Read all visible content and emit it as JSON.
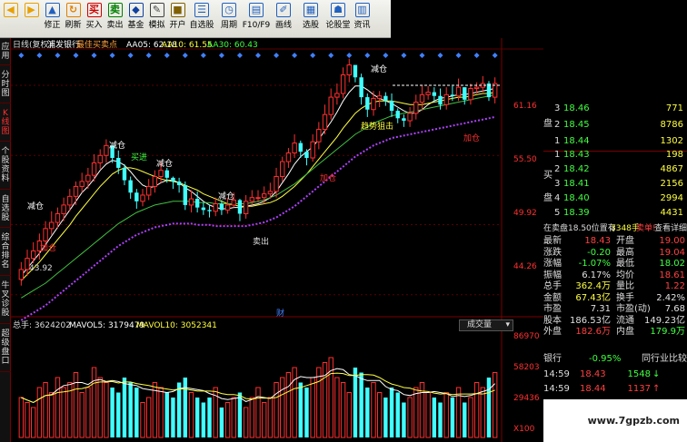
{
  "toolbar": {
    "buttons": [
      {
        "label": "",
        "icon": "back-arrow-icon",
        "color": "#e8a000"
      },
      {
        "label": "",
        "icon": "forward-arrow-icon",
        "color": "#e8a000"
      },
      {
        "label": "修正",
        "icon": "up-arrow-icon",
        "color": "#2060c0"
      },
      {
        "label": "刷新",
        "icon": "refresh-icon",
        "color": "#e08000"
      },
      {
        "label": "买入",
        "icon": "buy-icon",
        "color": "#d00000",
        "glyph": "买"
      },
      {
        "label": "卖出",
        "icon": "sell-icon",
        "color": "#008000",
        "glyph": "卖"
      },
      {
        "label": "基金",
        "icon": "fund-icon",
        "color": "#1040a0"
      },
      {
        "label": "模拟",
        "icon": "simulate-icon",
        "color": "#404040"
      },
      {
        "label": "开户",
        "icon": "lock-icon",
        "color": "#806000"
      },
      {
        "label": "自选股",
        "icon": "watchlist-icon",
        "color": "#2060c0",
        "wide": true
      },
      {
        "label": "周期",
        "icon": "period-icon",
        "color": "#2060c0",
        "wide": true
      },
      {
        "label": "F10/F9",
        "icon": "f10-icon",
        "color": "#2060c0",
        "wide": true
      },
      {
        "label": "画线",
        "icon": "pen-icon",
        "color": "#2060c0",
        "wide": true
      },
      {
        "label": "选股",
        "icon": "select-stock-icon",
        "color": "#2060c0",
        "wide": true
      },
      {
        "label": "论股堂",
        "icon": "forum-icon",
        "color": "#2060c0",
        "wide": true
      },
      {
        "label": "资讯",
        "icon": "news-icon",
        "color": "#2060c0"
      }
    ]
  },
  "left_tabs": [
    {
      "label": "应用"
    },
    {
      "label": "分时图"
    },
    {
      "label": "K线图",
      "active": true
    },
    {
      "label": "个股资料"
    },
    {
      "label": "自选股"
    },
    {
      "label": "综合排名"
    },
    {
      "label": "牛叉诊股"
    },
    {
      "label": "超级盘口"
    }
  ],
  "chart_header": {
    "period": "日线(复权)",
    "stock": "浦发银行",
    "indicator": "最佳买卖点",
    "ma5": "AA05: 62.18",
    "ma10": "AA10: 61.55",
    "ma30": "AA30: 60.43"
  },
  "price_axis": [
    "61.16",
    "55.50",
    "49.92",
    "44.26"
  ],
  "chart_labels": {
    "low": "43.92",
    "fin": "财",
    "trend": "趋势狙击",
    "jiacang": "加仓",
    "jiancang": "减仓",
    "maijin": "买进",
    "maichu": "卖出"
  },
  "volume_header": {
    "total": "总手: 3624202",
    "mavol5": "MAVOL5: 3179479",
    "mavol10": "MAVOL10: 3052341",
    "dropdown": "成交量"
  },
  "volume_axis": [
    "86970",
    "58203",
    "29436",
    "X100"
  ],
  "sell_orders": [
    {
      "level": "3",
      "price": "18.46",
      "vol": "771"
    },
    {
      "level": "2",
      "price": "18.45",
      "vol": "8786"
    },
    {
      "level": "1",
      "price": "18.44",
      "vol": "1302"
    }
  ],
  "buy_orders": [
    {
      "level": "1",
      "price": "18.43",
      "vol": "198"
    },
    {
      "level": "2",
      "price": "18.42",
      "vol": "4867"
    },
    {
      "level": "3",
      "price": "18.41",
      "vol": "2156"
    },
    {
      "level": "4",
      "price": "18.40",
      "vol": "2994"
    },
    {
      "level": "5",
      "price": "18.39",
      "vol": "4431"
    }
  ],
  "side_labels": {
    "sell": "盘",
    "buy1": "买",
    "buy2": "盘"
  },
  "order_note": {
    "text": "在卖盘18.50位置有",
    "vol": "3348手",
    "action": "卖单!",
    "link": "查看详细"
  },
  "stats": [
    {
      "l1": "最新",
      "v1": "18.43",
      "c1": "#ff4040",
      "l2": "开盘",
      "v2": "19.00",
      "c2": "#ff4040"
    },
    {
      "l1": "涨跌",
      "v1": "-0.20",
      "c1": "#40ff40",
      "l2": "最高",
      "v2": "19.04",
      "c2": "#ff4040"
    },
    {
      "l1": "涨幅",
      "v1": "-1.07%",
      "c1": "#40ff40",
      "l2": "最低",
      "v2": "18.02",
      "c2": "#40ff40"
    },
    {
      "l1": "振幅",
      "v1": "6.17%",
      "c1": "#e0e0e0",
      "l2": "均价",
      "v2": "18.61",
      "c2": "#ff4040"
    },
    {
      "l1": "总手",
      "v1": "362.4万",
      "c1": "#ffff40",
      "l2": "量比",
      "v2": "1.22",
      "c2": "#ff4040"
    },
    {
      "l1": "金额",
      "v1": "67.43亿",
      "c1": "#ffff40",
      "l2": "换手",
      "v2": "2.42%",
      "c2": "#e0e0e0"
    },
    {
      "l1": "市盈",
      "v1": "7.31",
      "c1": "#e0e0e0",
      "l2": "市盈(动)",
      "v2": "7.68",
      "c2": "#e0e0e0"
    },
    {
      "l1": "股本",
      "v1": "186.53亿",
      "c1": "#e0e0e0",
      "l2": "流通",
      "v2": "149.23亿",
      "c2": "#e0e0e0"
    },
    {
      "l1": "外盘",
      "v1": "182.6万",
      "c1": "#ff4040",
      "l2": "内盘",
      "v2": "179.9万",
      "c2": "#40ff40"
    }
  ],
  "industry": {
    "name": "银行",
    "change": "-0.95%",
    "button": "同行业比较"
  },
  "ticks": [
    {
      "time": "14:59",
      "price": "18.43",
      "vol": "1548",
      "arrow": "↓",
      "color": "#40ff40"
    },
    {
      "time": "14:59",
      "price": "18.44",
      "vol": "1137",
      "arrow": "↑",
      "color": "#ff4040"
    }
  ],
  "watermark": "www.7gpzb.com",
  "chart_data": {
    "type": "candlestick",
    "ylim": [
      43.0,
      63.5
    ],
    "open": [
      45.5,
      46.3,
      47.2,
      47.8,
      48.6,
      49.6,
      50.1,
      50.8,
      51.5,
      52.2,
      53.0,
      53.4,
      53.9,
      54.9,
      55.5,
      56.3,
      55.3,
      54.5,
      53.5,
      52.5,
      51.8,
      52.3,
      53.0,
      53.8,
      54.3,
      53.7,
      53.4,
      53.1,
      51.5,
      52.0,
      51.3,
      51.1,
      51.0,
      51.6,
      51.1,
      51.5,
      51.9,
      50.8,
      51.8,
      52.1,
      52.1,
      52.4,
      52.6,
      53.8,
      55.0,
      55.7,
      56.5,
      55.8,
      55.3,
      56.6,
      57.6,
      58.8,
      60.2,
      60.5,
      62.0,
      62.8,
      61.8,
      60.2,
      59.2,
      60.1,
      60.3,
      59.9,
      59.1,
      58.5,
      58.3,
      58.9,
      59.8,
      60.4,
      60.6,
      60.3,
      59.6,
      60.4,
      60.3,
      61.0,
      60.0,
      60.9,
      61.0,
      61.3,
      60.2
    ],
    "close": [
      46.3,
      47.2,
      47.8,
      48.6,
      49.6,
      50.1,
      50.8,
      51.5,
      52.2,
      53.0,
      53.4,
      53.9,
      54.9,
      55.5,
      56.3,
      55.3,
      54.5,
      53.5,
      52.5,
      51.8,
      52.3,
      53.0,
      53.8,
      54.3,
      53.7,
      53.4,
      53.1,
      51.5,
      52.0,
      51.3,
      51.1,
      51.0,
      51.6,
      51.1,
      51.5,
      51.9,
      50.8,
      51.8,
      52.1,
      52.1,
      52.4,
      52.6,
      53.8,
      55.0,
      55.7,
      56.5,
      55.8,
      55.3,
      56.6,
      57.6,
      58.8,
      60.2,
      60.5,
      62.0,
      62.8,
      61.8,
      60.2,
      59.2,
      60.1,
      60.3,
      59.9,
      59.1,
      58.5,
      58.3,
      58.9,
      59.8,
      60.4,
      60.6,
      60.3,
      59.6,
      60.4,
      60.3,
      61.0,
      60.0,
      60.9,
      61.0,
      61.3,
      60.2,
      61.3
    ],
    "high": [
      46.9,
      47.9,
      48.5,
      49.2,
      50.2,
      51.0,
      51.3,
      52.1,
      52.8,
      53.4,
      54.1,
      54.5,
      55.6,
      56.0,
      56.8,
      56.3,
      55.9,
      54.8,
      53.8,
      52.8,
      52.8,
      53.6,
      54.3,
      55.0,
      54.5,
      53.8,
      53.7,
      53.4,
      52.7,
      52.6,
      51.7,
      51.5,
      52.1,
      51.9,
      52.1,
      52.5,
      52.0,
      52.3,
      52.7,
      52.7,
      53.0,
      53.3,
      54.5,
      55.4,
      56.1,
      57.2,
      56.7,
      56.0,
      57.2,
      58.2,
      59.6,
      60.9,
      61.3,
      62.6,
      63.3,
      62.5,
      62.1,
      60.5,
      60.7,
      60.7,
      60.6,
      60.5,
      59.3,
      58.8,
      59.4,
      60.4,
      61.2,
      61.1,
      61.0,
      60.9,
      61.0,
      61.1,
      61.7,
      61.0,
      61.3,
      61.4,
      61.9,
      61.5,
      61.8
    ],
    "low": [
      45.0,
      45.8,
      46.8,
      47.1,
      48.1,
      49.1,
      49.6,
      50.2,
      51.0,
      51.5,
      52.5,
      52.8,
      53.4,
      54.4,
      54.9,
      54.9,
      54.0,
      53.1,
      52.0,
      51.2,
      51.4,
      51.9,
      52.5,
      53.3,
      53.3,
      52.8,
      52.5,
      51.1,
      50.9,
      50.9,
      50.7,
      50.5,
      50.6,
      50.7,
      50.8,
      51.3,
      50.2,
      50.4,
      51.5,
      51.7,
      51.6,
      52.0,
      52.1,
      53.4,
      54.5,
      55.3,
      55.3,
      54.7,
      55.0,
      56.0,
      57.2,
      58.4,
      59.6,
      60.1,
      61.4,
      61.4,
      59.6,
      58.6,
      58.7,
      59.4,
      59.5,
      58.6,
      58.1,
      57.8,
      57.8,
      58.4,
      59.1,
      60.0,
      59.8,
      59.2,
      59.2,
      59.9,
      59.9,
      59.6,
      59.6,
      60.5,
      60.6,
      59.9,
      59.7
    ],
    "volume": [
      0.4,
      0.35,
      0.3,
      0.5,
      0.55,
      0.45,
      0.6,
      0.5,
      0.55,
      0.65,
      0.45,
      0.5,
      0.7,
      0.6,
      0.55,
      0.5,
      0.45,
      0.6,
      0.55,
      0.5,
      0.35,
      0.4,
      0.55,
      0.5,
      0.45,
      0.4,
      0.55,
      0.6,
      0.45,
      0.4,
      0.35,
      0.4,
      0.5,
      0.3,
      0.35,
      0.4,
      0.45,
      0.3,
      0.4,
      0.5,
      0.35,
      0.4,
      0.55,
      0.6,
      0.65,
      0.7,
      0.55,
      0.5,
      0.6,
      0.7,
      0.75,
      0.8,
      0.6,
      0.55,
      0.45,
      0.7,
      0.65,
      0.5,
      0.55,
      0.45,
      0.4,
      0.5,
      0.45,
      0.35,
      0.4,
      0.5,
      0.55,
      0.45,
      0.4,
      0.35,
      0.45,
      0.4,
      0.5,
      0.35,
      0.4,
      0.55,
      0.5,
      0.6,
      0.65
    ],
    "series": [
      {
        "values": [
          45.8,
          46.4,
          47.0,
          47.6,
          48.3,
          49.0,
          49.7,
          50.4,
          51.1,
          51.8,
          52.5,
          53.0,
          53.6,
          54.3,
          54.8,
          55.1,
          55.0,
          54.7,
          54.2,
          53.6,
          53.1,
          52.9,
          53.0,
          53.3,
          53.5,
          53.5,
          53.3,
          52.9,
          52.6,
          52.2,
          51.8,
          51.5,
          51.3,
          51.2,
          51.2,
          51.3,
          51.3,
          51.4,
          51.5,
          51.6,
          51.8,
          52.1,
          52.6,
          53.3,
          54.0,
          54.8,
          55.4,
          55.8,
          56.2,
          56.8,
          57.5,
          58.2,
          59.0,
          59.9,
          60.6,
          61.1,
          61.1,
          60.8,
          60.4,
          60.1,
          59.9,
          59.7,
          59.4,
          59.1,
          58.9,
          58.9,
          59.2,
          59.6,
          59.9,
          60.1,
          60.2,
          60.3,
          60.4,
          60.4,
          60.5,
          60.6,
          60.7,
          60.8,
          60.9
        ]
      },
      {
        "values": [
          45.4,
          45.9,
          46.4,
          46.9,
          47.5,
          48.1,
          48.7,
          49.3,
          49.9,
          50.6,
          51.2,
          51.8,
          52.4,
          53.0,
          53.5,
          54.0,
          54.3,
          54.5,
          54.5,
          54.4,
          54.2,
          54.0,
          53.8,
          53.6,
          53.5,
          53.4,
          53.3,
          53.1,
          52.9,
          52.7,
          52.4,
          52.2,
          52.0,
          51.8,
          51.6,
          51.5,
          51.4,
          51.4,
          51.4,
          51.5,
          51.6,
          51.7,
          51.9,
          52.2,
          52.6,
          53.0,
          53.5,
          54.0,
          54.6,
          55.2,
          55.8,
          56.4,
          57.0,
          57.7,
          58.3,
          58.9,
          59.3,
          59.6,
          59.8,
          59.9,
          59.9,
          59.9,
          59.8,
          59.7,
          59.6,
          59.6,
          59.6,
          59.7,
          59.8,
          59.9,
          60.0,
          60.1,
          60.2,
          60.2,
          60.3,
          60.4,
          60.5,
          60.5,
          60.6
        ]
      },
      {
        "values": [
          44.0,
          44.3,
          44.6,
          44.9,
          45.2,
          45.6,
          46.0,
          46.4,
          46.8,
          47.2,
          47.6,
          48.0,
          48.4,
          48.8,
          49.2,
          49.6,
          50.0,
          50.3,
          50.6,
          50.9,
          51.1,
          51.3,
          51.5,
          51.6,
          51.7,
          51.8,
          51.8,
          51.8,
          51.8,
          51.7,
          51.7,
          51.7,
          51.6,
          51.6,
          51.6,
          51.6,
          51.6,
          51.6,
          51.7,
          51.8,
          51.9,
          52.1,
          52.3,
          52.6,
          52.9,
          53.2,
          53.6,
          54.0,
          54.4,
          54.8,
          55.2,
          55.6,
          56.0,
          56.4,
          56.8,
          57.2,
          57.5,
          57.8,
          58.1,
          58.3,
          58.5,
          58.7,
          58.8,
          58.9,
          59.0,
          59.1,
          59.2,
          59.3,
          59.4,
          59.5,
          59.6,
          59.7,
          59.8,
          59.9,
          60.0,
          60.1,
          60.2,
          60.3,
          60.4
        ]
      }
    ]
  }
}
